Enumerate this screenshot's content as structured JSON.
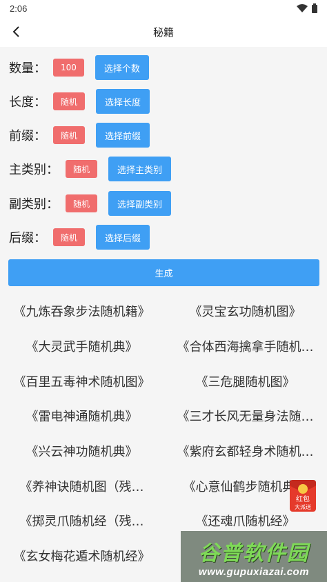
{
  "status_bar": {
    "time": "2:06"
  },
  "app_bar": {
    "title": "秘籍"
  },
  "settings": [
    {
      "key": "count",
      "label": "数量：",
      "value": "100",
      "button": "选择个数"
    },
    {
      "key": "length",
      "label": "长度：",
      "value": "随机",
      "button": "选择长度"
    },
    {
      "key": "prefix",
      "label": "前缀：",
      "value": "随机",
      "button": "选择前缀"
    },
    {
      "key": "main_category",
      "label": "主类别：",
      "value": "随机",
      "button": "选择主类别"
    },
    {
      "key": "sub_category",
      "label": "副类别：",
      "value": "随机",
      "button": "选择副类别"
    },
    {
      "key": "suffix",
      "label": "后缀：",
      "value": "随机",
      "button": "选择后缀"
    }
  ],
  "generate_button": "生成",
  "results": [
    "《九炼吞象步法随机籍》",
    "《灵宝玄功随机图》",
    "《大灵武手随机典》",
    "《合体西海擒拿手随机…",
    "《百里五毒神术随机图》",
    "《三危腿随机图》",
    "《雷电神通随机典》",
    "《三才长风无量身法随…",
    "《兴云神功随机典》",
    "《紫府玄都轻身术随机…",
    "《养神诀随机图（残…",
    "《心意仙鹤步随机典》",
    "《掷灵爪随机经（残…",
    "《还魂爪随机经》",
    "《玄女梅花遁术随机经》",
    ""
  ],
  "overlays": {
    "redpacket_text": "红包大派送",
    "watermark_title": "谷普软件园",
    "watermark_url": "www.gupuxiazai.com"
  },
  "colors": {
    "accent_blue": "#3f9ff4",
    "badge_red": "#f06d6d",
    "background": "#f5f5f5"
  }
}
